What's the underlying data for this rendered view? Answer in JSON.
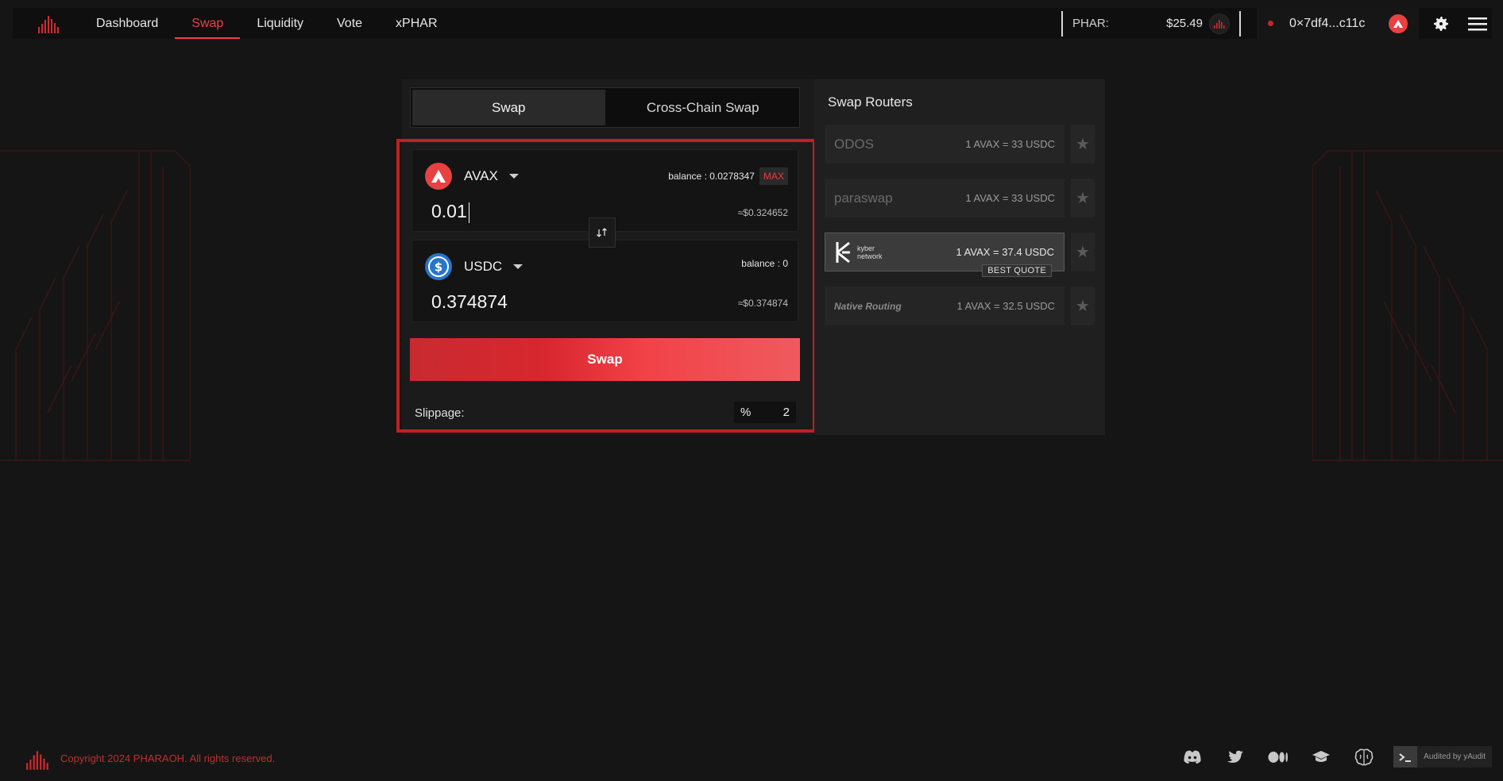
{
  "nav": {
    "items": [
      {
        "label": "Dashboard",
        "active": false
      },
      {
        "label": "Swap",
        "active": true
      },
      {
        "label": "Liquidity",
        "active": false
      },
      {
        "label": "Vote",
        "active": false
      },
      {
        "label": "xPHAR",
        "active": false
      }
    ]
  },
  "header": {
    "token_label": "PHAR:",
    "token_price": "$25.49",
    "wallet_address": "0×7df4...c11c"
  },
  "swap": {
    "tabs": [
      "Swap",
      "Cross-Chain Swap"
    ],
    "active_tab": "Swap",
    "from": {
      "symbol": "AVAX",
      "balance_label": "balance",
      "balance_value": ": 0.0278347",
      "max_label": "MAX",
      "amount": "0.01",
      "usd_value": "≈$0.324652"
    },
    "to": {
      "symbol": "USDC",
      "balance_label": "balance",
      "balance_value": ": 0",
      "amount": "0.374874",
      "usd_value": "≈$0.374874"
    },
    "button_label": "Swap",
    "slippage_label": "Slippage:",
    "slippage_unit": "%",
    "slippage_value": "2"
  },
  "routers": {
    "title": "Swap Routers",
    "items": [
      {
        "name": "ODOS",
        "rate": "1 AVAX = 33 USDC",
        "best": false
      },
      {
        "name": "paraswap",
        "rate": "1 AVAX = 33 USDC",
        "best": false
      },
      {
        "name": "kyber network",
        "rate": "1 AVAX = 37.4 USDC",
        "best": true
      },
      {
        "name": "Native Routing",
        "rate": "1 AVAX = 32.5 USDC",
        "best": false
      }
    ],
    "best_label": "BEST QUOTE"
  },
  "footer": {
    "copyright": "Copyright 2024 PHARAOH. All rights reserved.",
    "audit_label": "Audited by yAudit"
  },
  "colors": {
    "accent": "#ef4146",
    "highlight": "#c41e23",
    "background": "#151515"
  }
}
